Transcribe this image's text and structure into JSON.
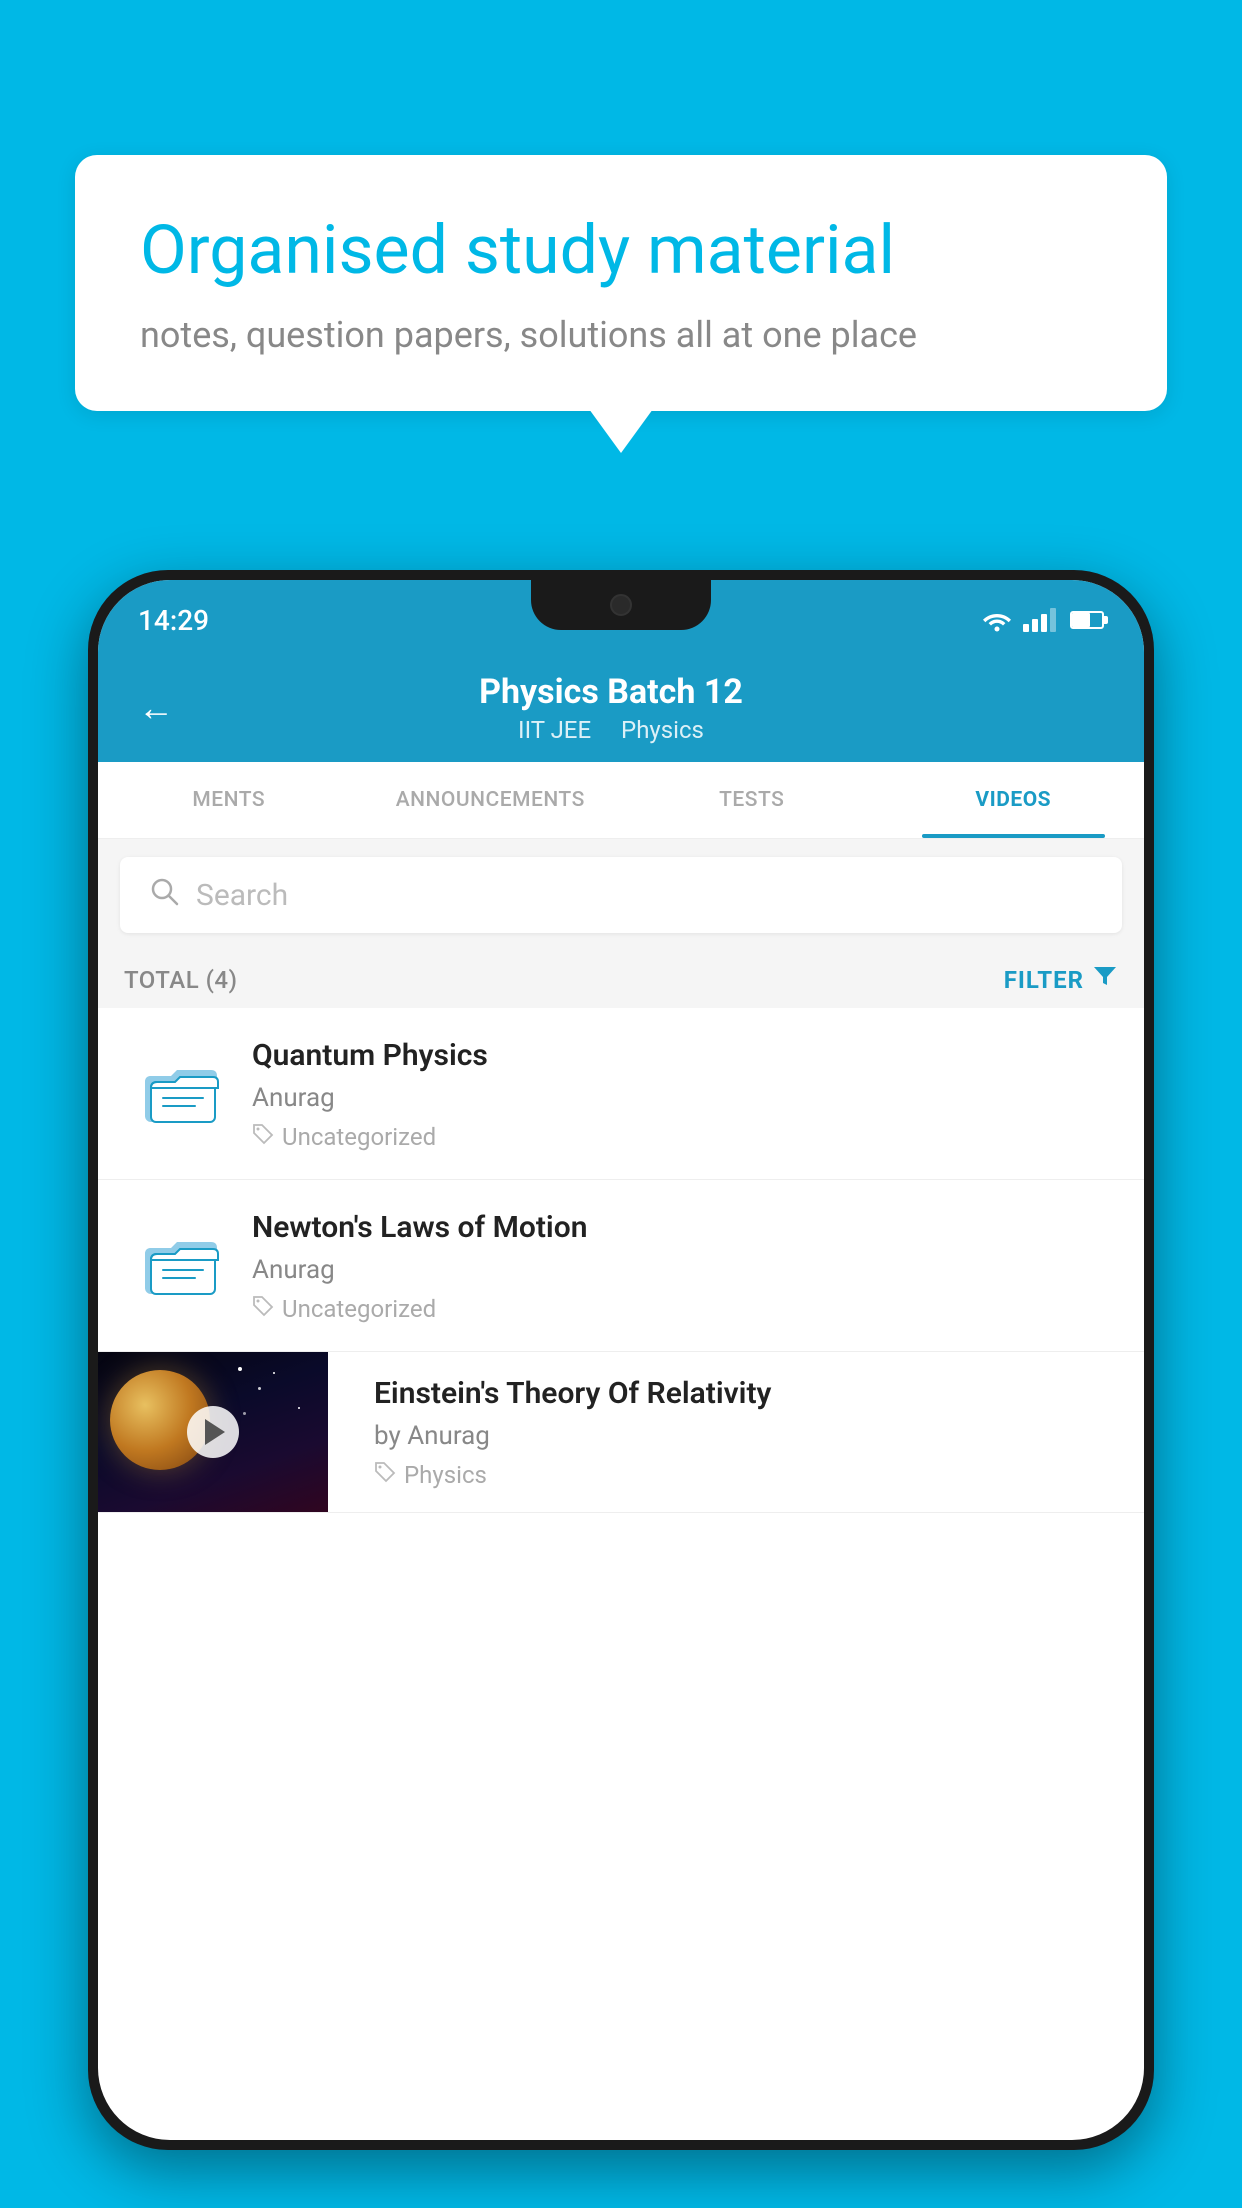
{
  "background_color": "#00b8e6",
  "speech_bubble": {
    "headline": "Organised study material",
    "subtext": "notes, question papers, solutions all at one place"
  },
  "phone": {
    "status_bar": {
      "time": "14:29",
      "wifi": true,
      "battery_percent": 60
    },
    "header": {
      "back_label": "←",
      "title": "Physics Batch 12",
      "subtitle_part1": "IIT JEE",
      "subtitle_part2": "Physics"
    },
    "tabs": [
      {
        "label": "MENTS",
        "active": false
      },
      {
        "label": "ANNOUNCEMENTS",
        "active": false
      },
      {
        "label": "TESTS",
        "active": false
      },
      {
        "label": "VIDEOS",
        "active": true
      }
    ],
    "search": {
      "placeholder": "Search"
    },
    "filter_bar": {
      "total_label": "TOTAL (4)",
      "filter_label": "FILTER"
    },
    "videos": [
      {
        "id": 1,
        "title": "Quantum Physics",
        "author": "Anurag",
        "tag": "Uncategorized",
        "has_thumbnail": false
      },
      {
        "id": 2,
        "title": "Newton's Laws of Motion",
        "author": "Anurag",
        "tag": "Uncategorized",
        "has_thumbnail": false
      },
      {
        "id": 3,
        "title": "Einstein's Theory Of Relativity",
        "author": "by Anurag",
        "tag": "Physics",
        "has_thumbnail": true
      }
    ]
  }
}
